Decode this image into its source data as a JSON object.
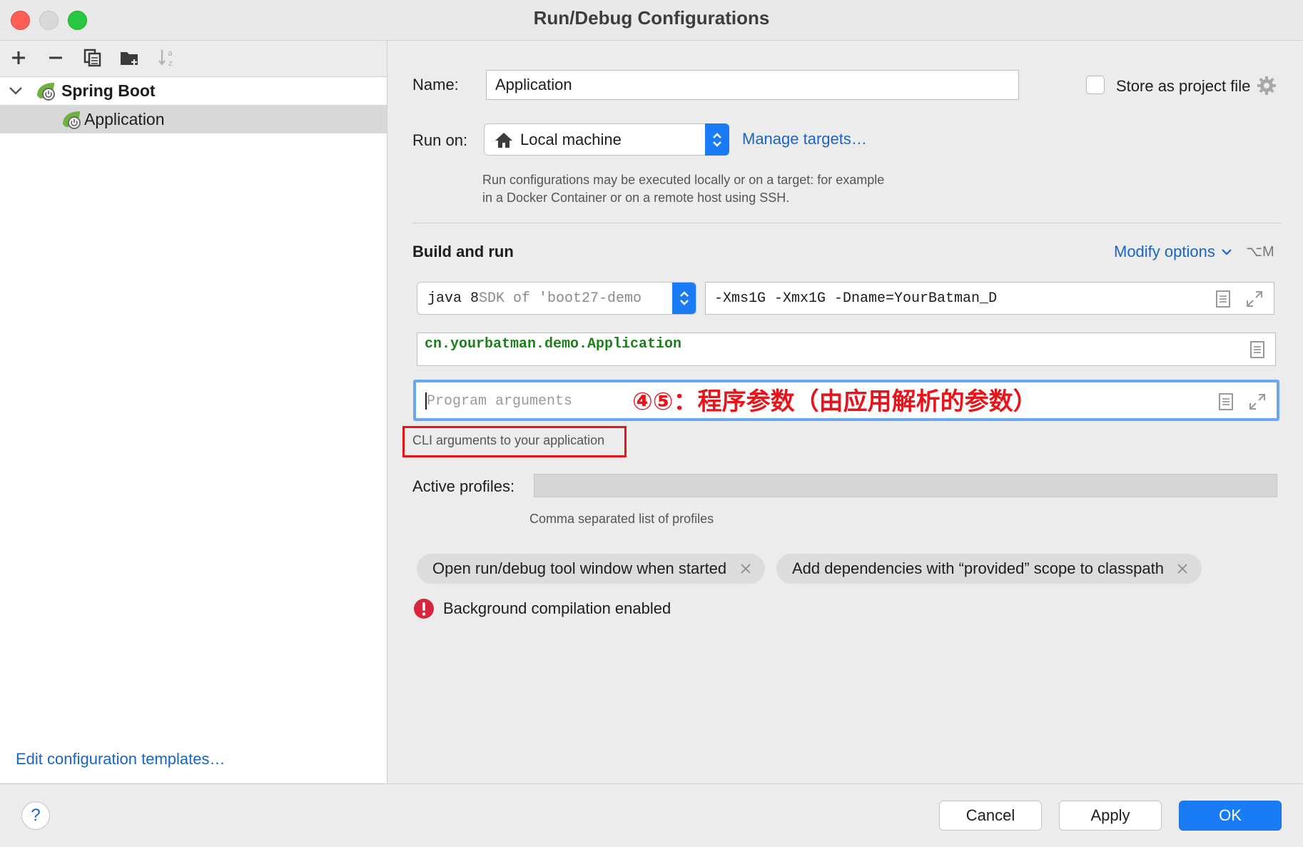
{
  "window": {
    "title": "Run/Debug Configurations"
  },
  "tree": {
    "group_label": "Spring Boot",
    "item_label": "Application"
  },
  "left_footer": {
    "edit_templates": "Edit configuration templates…"
  },
  "form": {
    "name_label": "Name:",
    "name_value": "Application",
    "store_label": "Store as project file",
    "run_on_label": "Run on:",
    "run_on_value": "Local machine",
    "manage_targets": "Manage targets…",
    "run_on_hint_1": "Run configurations may be executed locally or on a target: for example",
    "run_on_hint_2": "in a Docker Container or on a remote host using SSH.",
    "build_and_run": "Build and run",
    "modify_options": "Modify options",
    "modify_shortcut": "⌥M",
    "jdk_main": "java 8",
    "jdk_suffix": " SDK of 'boot27-demo",
    "vm_options": "-Xms1G -Xmx1G -Dname=YourBatman_D",
    "main_class": "cn.yourbatman.demo.Application",
    "program_args_placeholder": "Program arguments",
    "annotation": "④⑤：程序参数（由应用解析的参数）",
    "program_args_hint": "CLI arguments to your application",
    "active_profiles_label": "Active profiles:",
    "active_profiles_hint": "Comma separated list of profiles",
    "chip_1": "Open run/debug tool window when started",
    "chip_2": "Add dependencies with “provided” scope to classpath",
    "warning_text": "Background compilation enabled"
  },
  "buttons": {
    "help": "?",
    "cancel": "Cancel",
    "apply": "Apply",
    "ok": "OK"
  },
  "colors": {
    "accent": "#1a7cf5",
    "link": "#1a64c4",
    "annotation_red": "#e8141b",
    "warning_red": "#d7263d",
    "main_class_green": "#1c7f1c"
  }
}
